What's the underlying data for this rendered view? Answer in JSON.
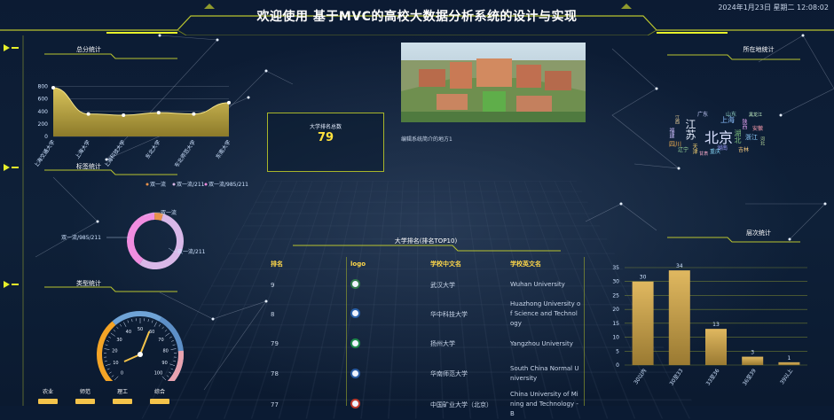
{
  "header": {
    "title": "欢迎使用 基于MVC的高校大数据分析系统的设计与实现",
    "datetime": "2024年1月23日 星期二 12:08:02"
  },
  "panels": {
    "total_stats": "总分统计",
    "tag_stats": "标签统计",
    "type_stats": "类型统计",
    "location_stats": "所在地统计",
    "level_stats": "层次统计",
    "rank_top10": "大学排名(排名TOP10)"
  },
  "kpi": {
    "label": "大学排名总数",
    "value": "79"
  },
  "campus_image_caption": "编辑系统简介的地方1",
  "table": {
    "headers": [
      "排名",
      "logo",
      "学校中文名",
      "学校英文名"
    ],
    "rows": [
      {
        "rank": "9",
        "cn": "武汉大学",
        "en": "Wuhan University",
        "logo_color": "#2f7a4a"
      },
      {
        "rank": "8",
        "cn": "华中科技大学",
        "en": "Huazhong University of Science and Technology",
        "logo_color": "#2860a8"
      },
      {
        "rank": "79",
        "cn": "扬州大学",
        "en": "Yangzhou University",
        "logo_color": "#1e8a4a"
      },
      {
        "rank": "78",
        "cn": "华南师范大学",
        "en": "South China Normal University",
        "logo_color": "#2a5ba0"
      },
      {
        "rank": "77",
        "cn": "中国矿业大学（北京）",
        "en": "China University of Mining and Technology - B",
        "logo_color": "#c0392b"
      }
    ]
  },
  "type_categories": [
    "农业",
    "师范",
    "理工",
    "综合"
  ],
  "donut": {
    "labels": [
      "双一流",
      "双一流/211",
      "双一流/985/211"
    ],
    "colors": [
      "#e8924a",
      "#d9b8e8",
      "#f08de0"
    ]
  },
  "gauge": {
    "min_label": "0",
    "max_label": "100",
    "value_pct": 58
  },
  "wordcloud": {
    "words": [
      "北京",
      "江苏",
      "上海",
      "广东",
      "湖北",
      "山东",
      "四川",
      "陕西",
      "浙江",
      "辽宁",
      "天津",
      "湖南",
      "安徽",
      "福建",
      "重庆",
      "吉林",
      "河北",
      "甘肃",
      "黑龙江",
      "江西"
    ]
  },
  "chart_data": [
    {
      "type": "area",
      "title": "总分统计",
      "categories": [
        "上海交通大学",
        "上海大学",
        "上海科技大学",
        "东北大学",
        "东北师范大学",
        "东南大学"
      ],
      "values": [
        780,
        360,
        340,
        380,
        360,
        540
      ],
      "yticks": [
        "800",
        "600",
        "400",
        "200",
        "0"
      ],
      "ylim": [
        0,
        850
      ]
    },
    {
      "type": "pie",
      "title": "标签统计",
      "legend": [
        "双一流",
        "双一流/211",
        "双一流/985/211"
      ],
      "values": [
        5,
        55,
        40
      ]
    },
    {
      "type": "bar",
      "title": "层次统计",
      "categories": [
        "30以内",
        "30至33",
        "33至36",
        "36至39",
        "39以上"
      ],
      "values": [
        30,
        34,
        13,
        3,
        1
      ],
      "yticks": [
        "35",
        "30",
        "25",
        "20",
        "15",
        "10",
        "5",
        "0"
      ],
      "ylim": [
        0,
        35
      ]
    }
  ]
}
